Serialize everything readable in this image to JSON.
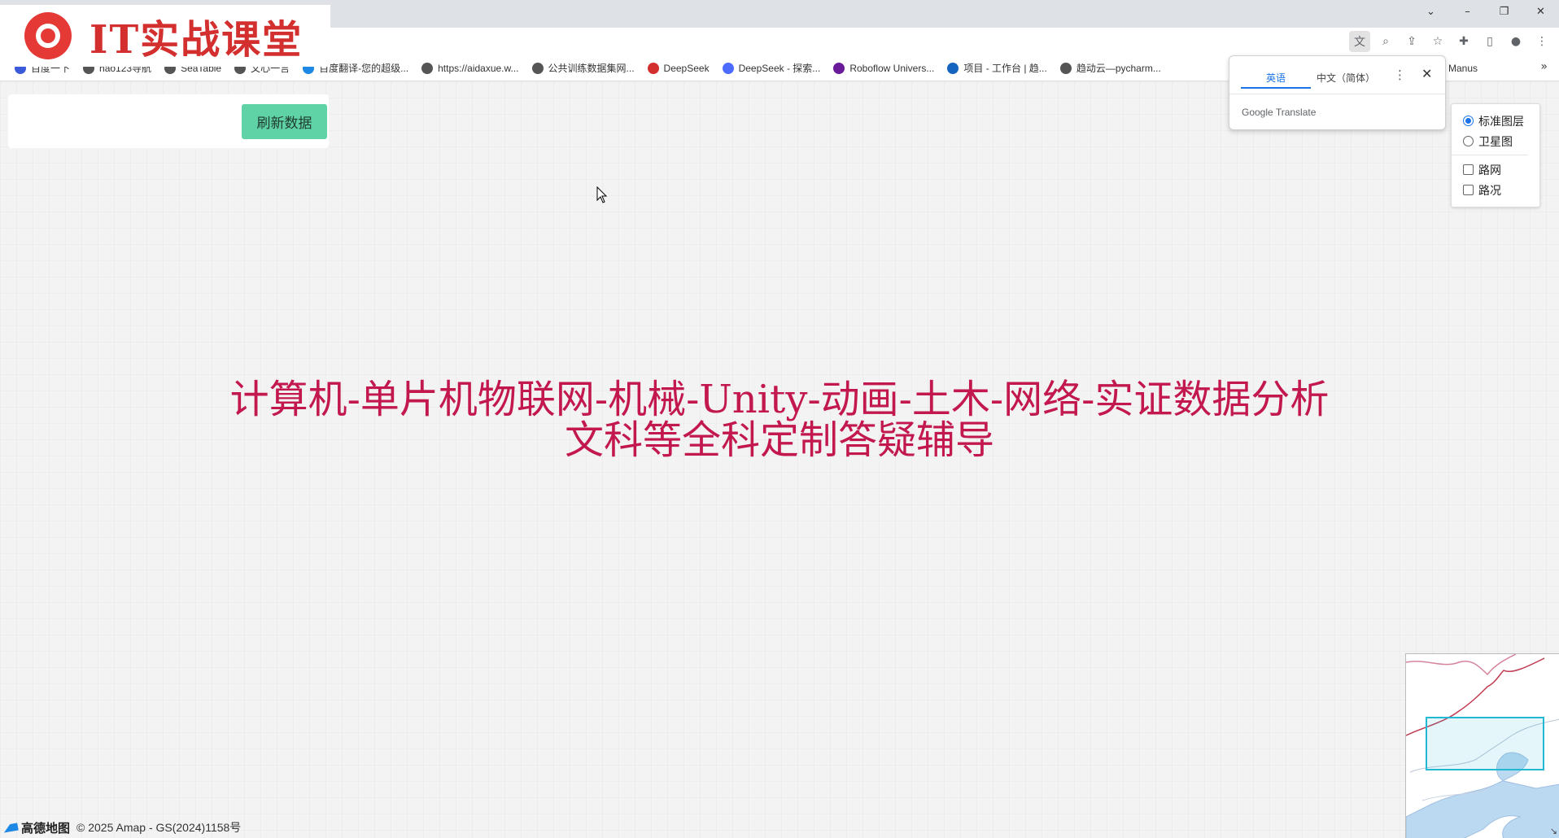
{
  "browser": {
    "window_controls": {
      "dropdown": "⌄",
      "minimize": "–",
      "restore": "❐",
      "close": "✕"
    },
    "toolbar_icons": [
      {
        "name": "translate-icon",
        "glyph": "文"
      },
      {
        "name": "zoom-icon",
        "glyph": "⌕"
      },
      {
        "name": "share-icon",
        "glyph": "⇪"
      },
      {
        "name": "star-icon",
        "glyph": "☆"
      },
      {
        "name": "extensions-icon",
        "glyph": "✚"
      },
      {
        "name": "sidepanel-icon",
        "glyph": "▯"
      },
      {
        "name": "profile-icon",
        "glyph": "●"
      },
      {
        "name": "menu-icon",
        "glyph": "⋮"
      }
    ],
    "bookmarks": [
      {
        "label": "百度一下",
        "icon_color": "#3b5bdb"
      },
      {
        "label": "hao123导航",
        "icon_color": "#555555"
      },
      {
        "label": "SeaTable",
        "icon_color": "#555555"
      },
      {
        "label": "文心一言",
        "icon_color": "#555555"
      },
      {
        "label": "百度翻译-您的超级...",
        "icon_color": "#1e88e5"
      },
      {
        "label": "https://aidaxue.w...",
        "icon_color": "#555555"
      },
      {
        "label": "公共训练数据集网...",
        "icon_color": "#555555"
      },
      {
        "label": "DeepSeek",
        "icon_color": "#d32f2f"
      },
      {
        "label": "DeepSeek - 探索...",
        "icon_color": "#4d6bfe"
      },
      {
        "label": "Roboflow Univers...",
        "icon_color": "#6a1b9a"
      },
      {
        "label": "项目 - 工作台 | 趋...",
        "icon_color": "#1565c0"
      },
      {
        "label": "趋动云—pycharm...",
        "icon_color": "#555555"
      }
    ],
    "bookmark_manus": "Manus",
    "bookmarks_more": "»"
  },
  "logo": {
    "text": "IT实战课堂"
  },
  "control_panel": {
    "refresh_label": "刷新数据"
  },
  "translate_popup": {
    "tab_english": "英语",
    "tab_chinese": "中文（简体）",
    "menu": "⋮",
    "close": "✕",
    "footer": "Google Translate"
  },
  "layers": {
    "standard": "标准图层",
    "satellite": "卫星图",
    "roadnet": "路网",
    "traffic": "路况"
  },
  "promo": {
    "line1": "计算机-单片机物联网-机械-Unity-动画-土木-网络-实证数据分析",
    "line2": "文科等全科定制答疑辅导"
  },
  "attribution": {
    "brand": "高德地图",
    "copyright": "© 2025 Amap - GS(2024)1158号"
  },
  "minimap": {
    "corner": "↘"
  }
}
